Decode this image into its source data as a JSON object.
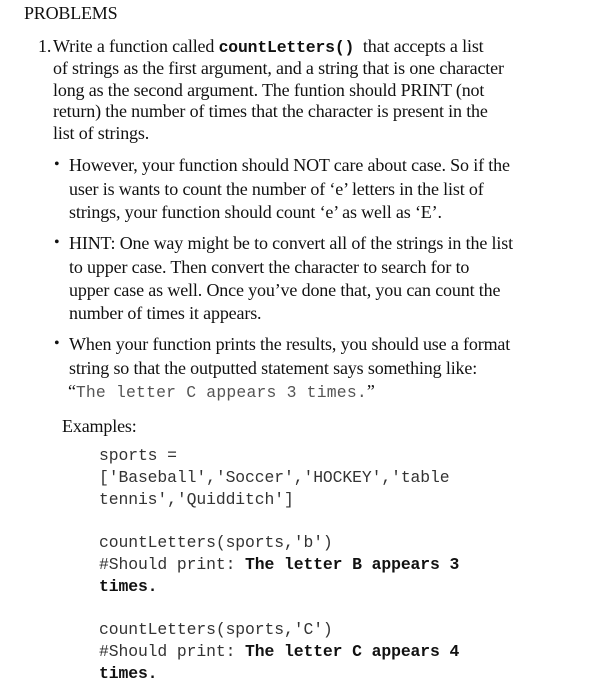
{
  "heading": "PROBLEMS",
  "problem": {
    "number": "1.",
    "intro_lines": [
      {
        "pre": "Write a function called ",
        "code": "countLetters()",
        "post": "  that accepts a list"
      },
      {
        "text": "of strings as the first argument, and a string that is one character"
      },
      {
        "text": "long as the second argument. The funtion should PRINT (not"
      },
      {
        "text": "return) the number of times that the character is present in the"
      },
      {
        "text": "list of strings."
      }
    ],
    "bullets": [
      {
        "symbol": "•",
        "lines": [
          "However, your function should NOT care about case. So if the",
          "user is wants to count the number of ‘e’ letters in the list of",
          "strings, your function should count ‘e’ as well as ‘E’."
        ]
      },
      {
        "symbol": "•",
        "lines": [
          "HINT: One way might be to convert all of the strings in the list",
          "to upper case. Then convert the character to search for to",
          "upper case as well. Once you’ve done that, you can count the",
          "number of times it appears."
        ]
      },
      {
        "symbol": "•",
        "lines": [
          "When your function prints the results, you should use a format",
          "string so that the outputted statement says something like:"
        ],
        "quote_open": "“",
        "quote_code": "The letter C appears 3 times.",
        "quote_close": "”"
      }
    ],
    "examples_label": "Examples:",
    "code": {
      "sports_lines": [
        "sports =",
        "['Baseball','Soccer','HOCKEY','table",
        "tennis','Quidditch']"
      ],
      "examples": [
        {
          "call": "countLetters(sports,'b')",
          "comment": "#Should print: ",
          "output_line1": "The letter B appears 3",
          "output_line2": "times."
        },
        {
          "call": "countLetters(sports,'C')",
          "comment": "#Should print: ",
          "output_line1": "The letter C appears 4",
          "output_line2": "times."
        }
      ]
    }
  }
}
